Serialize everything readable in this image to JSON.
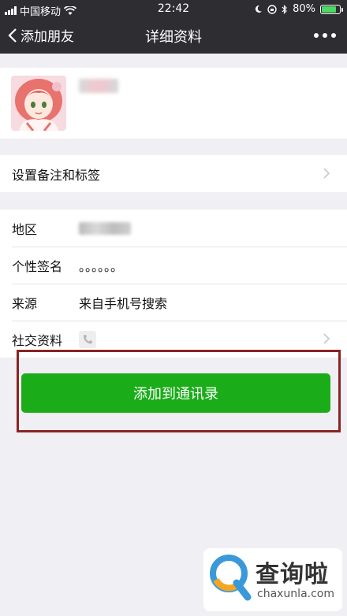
{
  "status_bar": {
    "carrier": "中国移动",
    "time": "22:42",
    "battery": "80%",
    "battery_level": 0.8
  },
  "nav": {
    "back_label": "添加朋友",
    "title": "详细资料"
  },
  "profile": {
    "name": ""
  },
  "remark_cell": {
    "label": "设置备注和标签"
  },
  "info": {
    "region_label": "地区",
    "signature_label": "个性签名",
    "signature_value": "。。。。。。",
    "source_label": "来源",
    "source_value": "来自手机号搜索",
    "social_label": "社交资料"
  },
  "add_button": {
    "label": "添加到通讯录",
    "color": "#1aad19"
  },
  "watermark": {
    "cn": "查询啦",
    "en": "chaxunla.com"
  },
  "colors": {
    "navbar": "#2e2e32",
    "background": "#efeff4",
    "highlight_border": "#8b2323"
  }
}
